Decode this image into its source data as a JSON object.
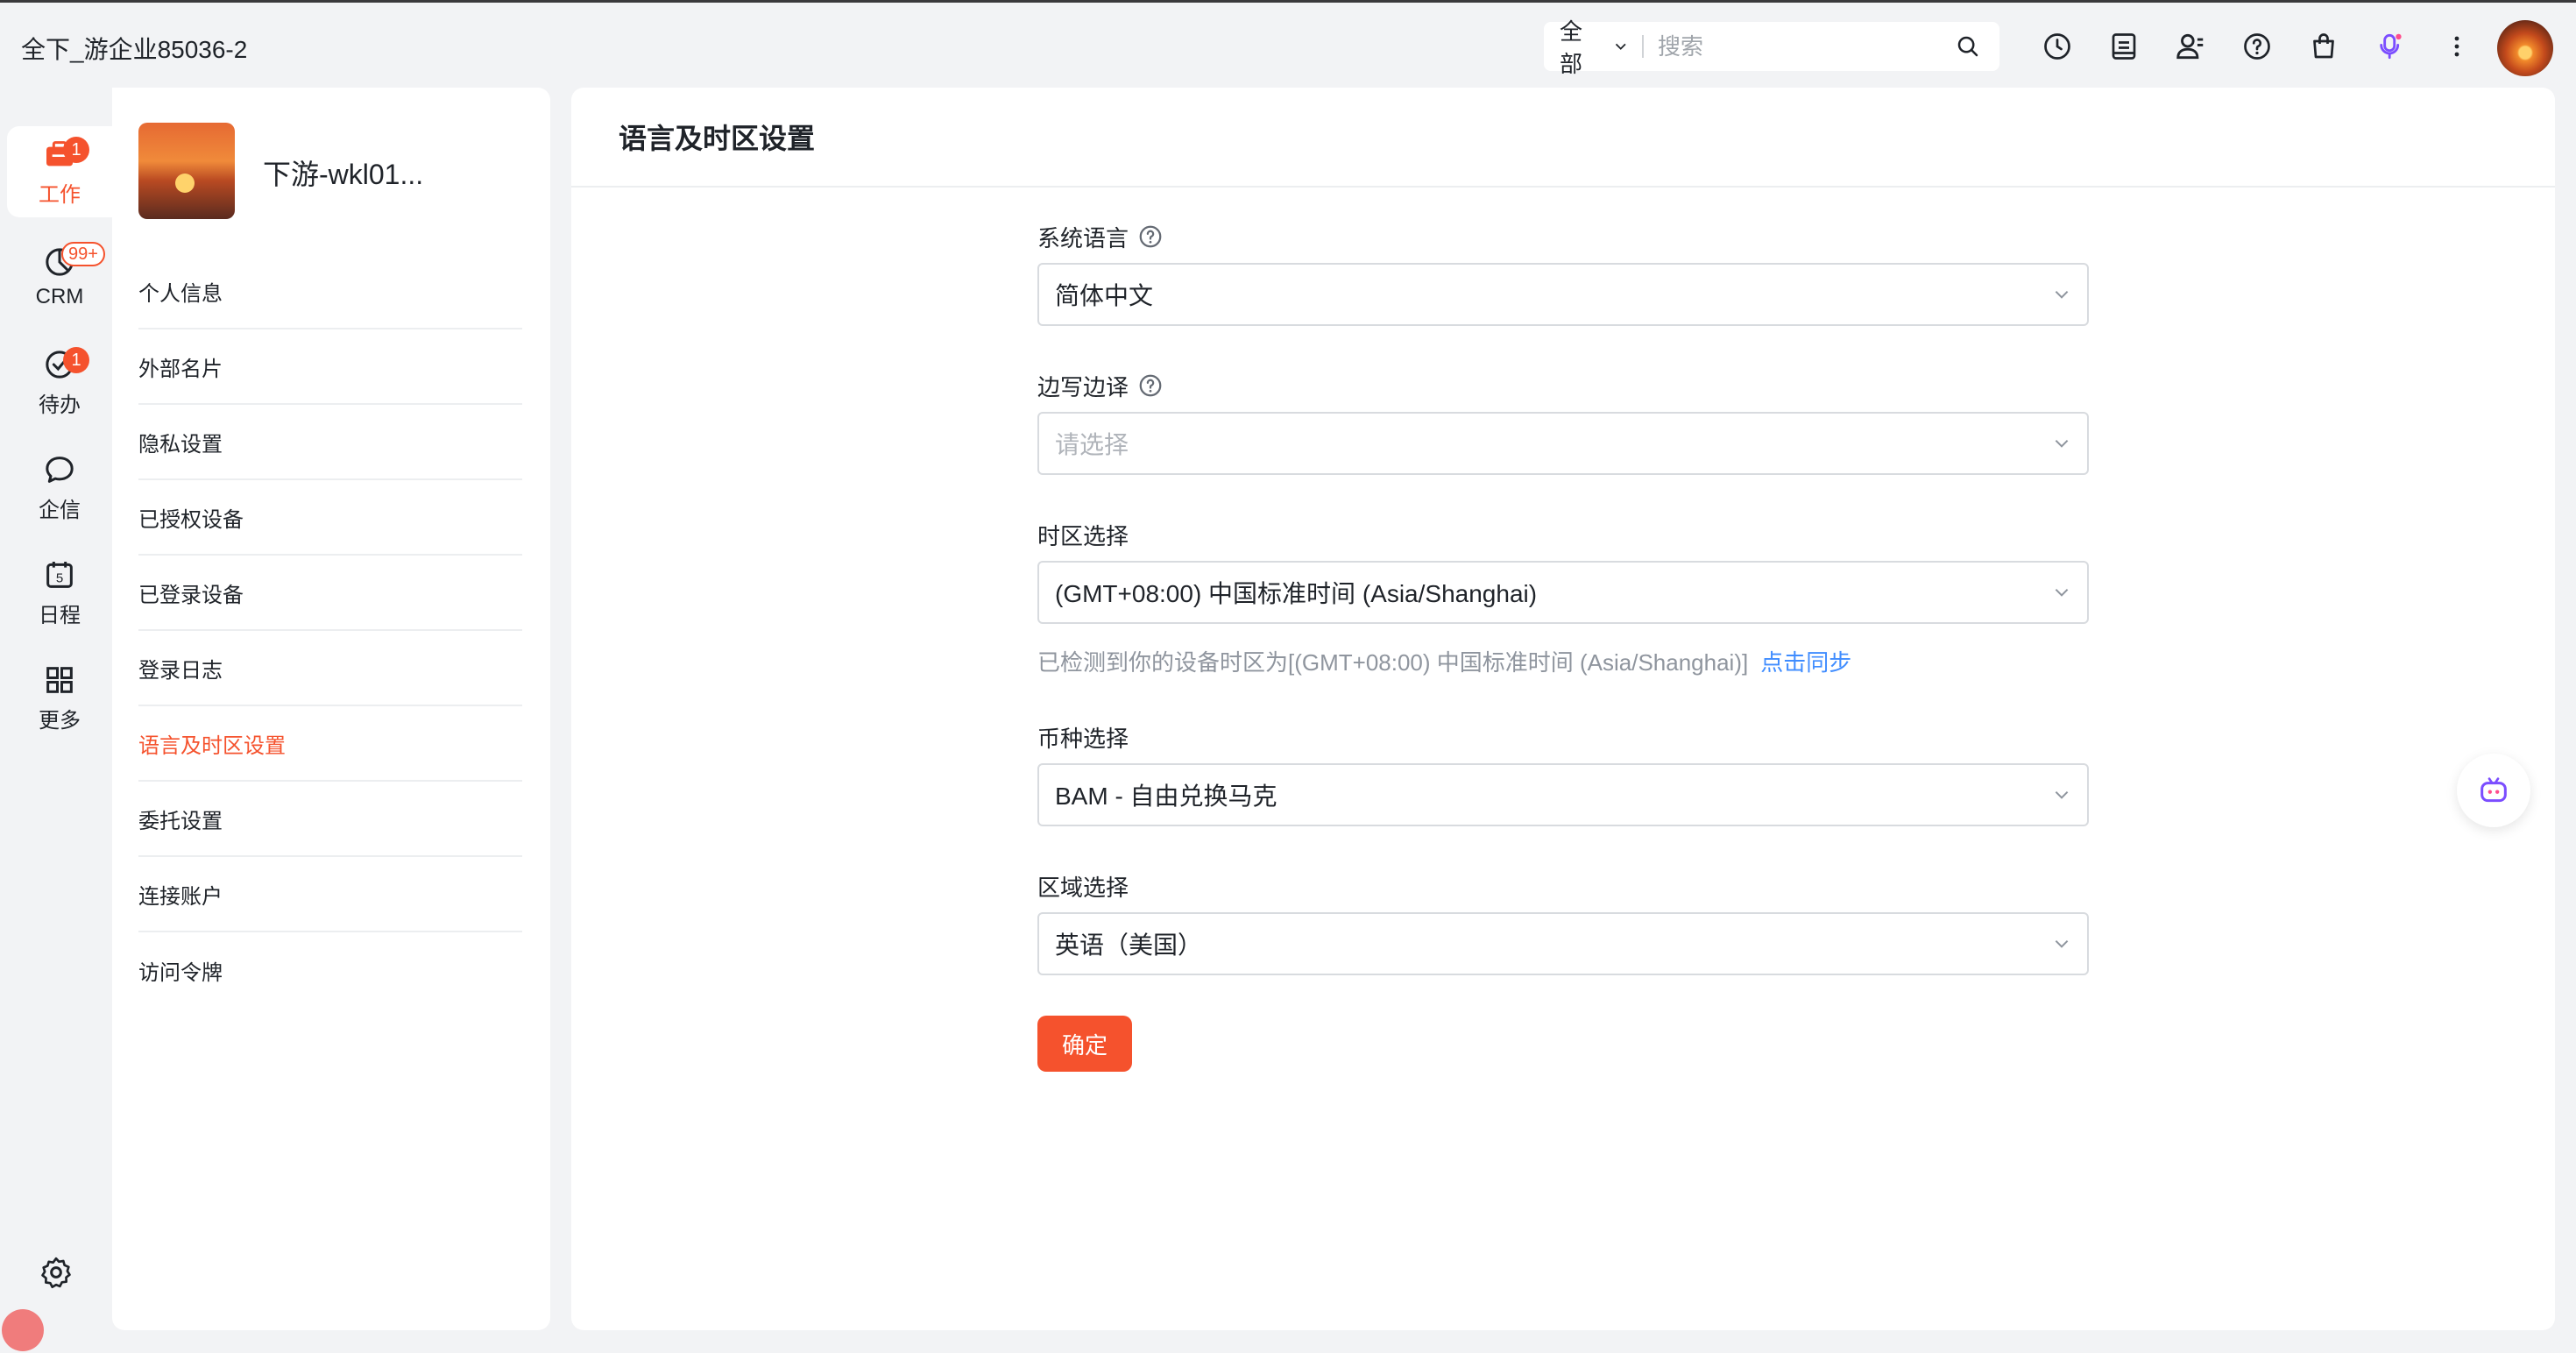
{
  "app": {
    "title": "全下_游企业85036-2"
  },
  "search": {
    "scope": "全部",
    "placeholder": "搜索"
  },
  "top_icons": [
    "clock-icon",
    "notes-icon",
    "contacts-icon",
    "help-icon",
    "bag-icon",
    "voice-assistant-icon",
    "more-icon"
  ],
  "rail": {
    "items": [
      {
        "label": "工作",
        "icon": "briefcase-icon",
        "badge": "1",
        "active": true
      },
      {
        "label": "CRM",
        "icon": "crm-icon",
        "badge": "99+"
      },
      {
        "label": "待办",
        "icon": "todo-check-icon",
        "badge": "1"
      },
      {
        "label": "企信",
        "icon": "chat-icon"
      },
      {
        "label": "日程",
        "icon": "calendar-icon",
        "calendar_day": "5"
      },
      {
        "label": "更多",
        "icon": "grid-icon"
      }
    ]
  },
  "profile": {
    "name": "下游-wkl01..."
  },
  "menu": {
    "items": [
      {
        "label": "个人信息"
      },
      {
        "label": "外部名片"
      },
      {
        "label": "隐私设置"
      },
      {
        "label": "已授权设备"
      },
      {
        "label": "已登录设备"
      },
      {
        "label": "登录日志"
      },
      {
        "label": "语言及时区设置",
        "active": true
      },
      {
        "label": "委托设置"
      },
      {
        "label": "连接账户"
      },
      {
        "label": "访问令牌"
      }
    ]
  },
  "page": {
    "title": "语言及时区设置",
    "fields": {
      "system_language": {
        "label": "系统语言",
        "value": "简体中文"
      },
      "translate": {
        "label": "边写边译",
        "placeholder": "请选择"
      },
      "timezone": {
        "label": "时区选择",
        "value": "(GMT+08:00) 中国标准时间 (Asia/Shanghai)",
        "hint": "已检测到你的设备时区为[(GMT+08:00) 中国标准时间 (Asia/Shanghai)]",
        "sync_link": "点击同步"
      },
      "currency": {
        "label": "币种选择",
        "value": "BAM - 自由兑换马克"
      },
      "region": {
        "label": "区域选择",
        "value": "英语（美国）"
      }
    },
    "confirm_label": "确定"
  },
  "colors": {
    "accent": "#f5522d",
    "link": "#3f8cff",
    "background": "#f2f3f5"
  }
}
